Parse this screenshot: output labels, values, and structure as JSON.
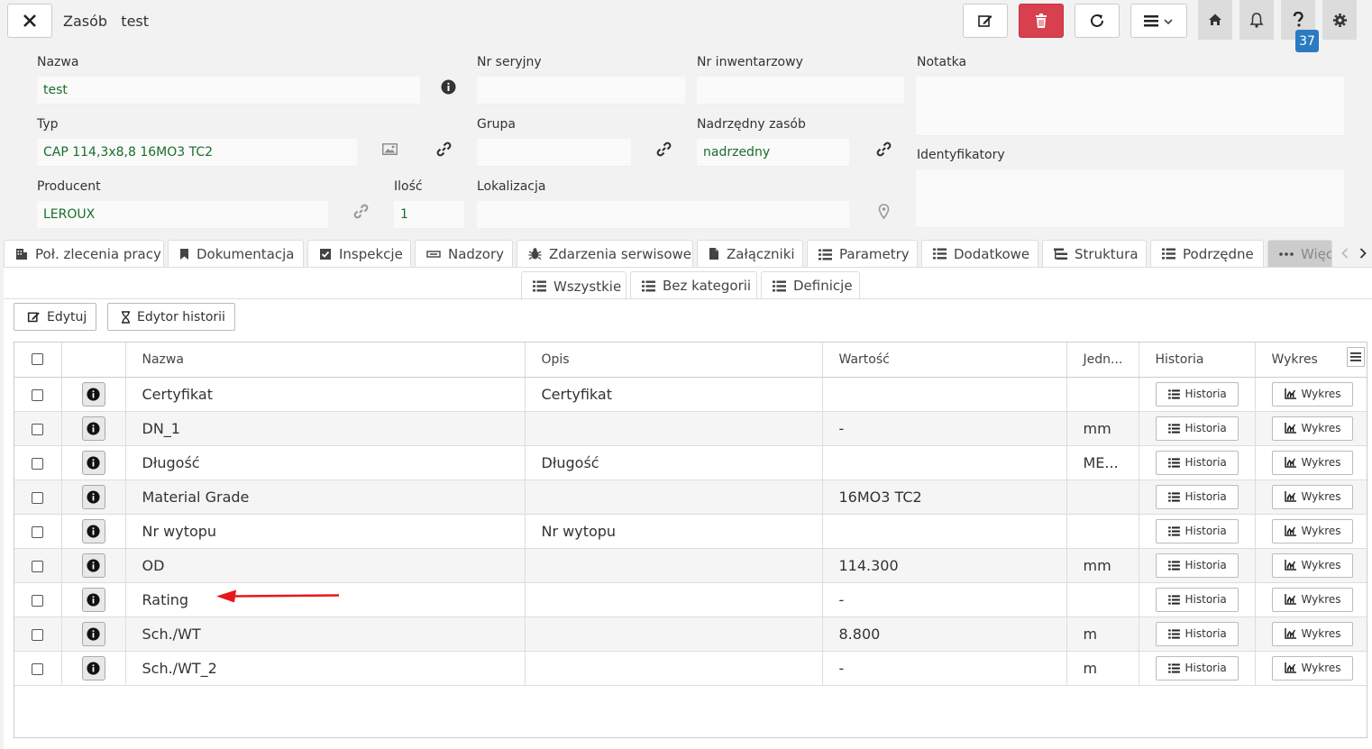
{
  "header": {
    "title": "Zasób   test",
    "notification_count": "37"
  },
  "form": {
    "nazwa": {
      "label": "Nazwa",
      "value": "test"
    },
    "nr_seryjny": {
      "label": "Nr seryjny",
      "value": ""
    },
    "nr_inwentarzowy": {
      "label": "Nr inwentarzowy",
      "value": ""
    },
    "notatka": {
      "label": "Notatka",
      "value": ""
    },
    "typ": {
      "label": "Typ",
      "value": "CAP 114,3x8,8 16MO3 TC2"
    },
    "grupa": {
      "label": "Grupa",
      "value": ""
    },
    "nadrzedny_zasob": {
      "label": "Nadrzędny zasób",
      "value": "nadrzedny"
    },
    "identyfikatory": {
      "label": "Identyfikatory",
      "value": ""
    },
    "producent": {
      "label": "Producent",
      "value": "LEROUX"
    },
    "ilosc": {
      "label": "Ilość",
      "value": "1"
    },
    "lokalizacja": {
      "label": "Lokalizacja",
      "value": ""
    }
  },
  "tabs": [
    {
      "label": "Poł. zlecenia pracy",
      "icon": "building-icon"
    },
    {
      "label": "Dokumentacja",
      "icon": "bookmark-icon"
    },
    {
      "label": "Inspekcje",
      "icon": "checkbox-icon"
    },
    {
      "label": "Nadzory",
      "icon": "minus-box-icon"
    },
    {
      "label": "Zdarzenia serwisowe",
      "icon": "bug-icon"
    },
    {
      "label": "Załączniki",
      "icon": "file-icon"
    },
    {
      "label": "Parametry",
      "icon": "list-icon"
    },
    {
      "label": "Dodatkowe",
      "icon": "list-icon"
    },
    {
      "label": "Struktura",
      "icon": "tree-icon"
    },
    {
      "label": "Podrzędne",
      "icon": "list-icon"
    },
    {
      "label": "Więc",
      "icon": "ellipsis-icon"
    }
  ],
  "subtabs": [
    {
      "label": "Wszystkie"
    },
    {
      "label": "Bez kategorii"
    },
    {
      "label": "Definicje"
    }
  ],
  "actions": {
    "edit_label": "Edytuj",
    "history_editor_label": "Edytor historii"
  },
  "table": {
    "columns": [
      "Nazwa",
      "Opis",
      "Wartość",
      "Jedn...",
      "Historia",
      "Wykres"
    ],
    "history_btn": "Historia",
    "chart_btn": "Wykres",
    "rows": [
      {
        "nazwa": "Certyfikat",
        "opis": "Certyfikat",
        "wartosc": "",
        "jedn": ""
      },
      {
        "nazwa": "DN_1",
        "opis": "",
        "wartosc": "-",
        "jedn": "mm"
      },
      {
        "nazwa": "Długość",
        "opis": "Długość",
        "wartosc": "",
        "jedn": "ME..."
      },
      {
        "nazwa": "Material Grade",
        "opis": "",
        "wartosc": "16MO3 TC2",
        "jedn": ""
      },
      {
        "nazwa": "Nr wytopu",
        "opis": "Nr wytopu",
        "wartosc": "",
        "jedn": ""
      },
      {
        "nazwa": "OD",
        "opis": "",
        "wartosc": "114.300",
        "jedn": "mm"
      },
      {
        "nazwa": "Rating",
        "opis": "",
        "wartosc": "-",
        "jedn": ""
      },
      {
        "nazwa": "Sch./WT",
        "opis": "",
        "wartosc": "8.800",
        "jedn": "m"
      },
      {
        "nazwa": "Sch./WT_2",
        "opis": "",
        "wartosc": "-",
        "jedn": "m"
      }
    ]
  },
  "colors": {
    "delete_red": "#d9404f",
    "value_green": "#1a6d2a",
    "badge_blue": "#2a7bc0",
    "annotation_arrow": "#e8171b"
  }
}
